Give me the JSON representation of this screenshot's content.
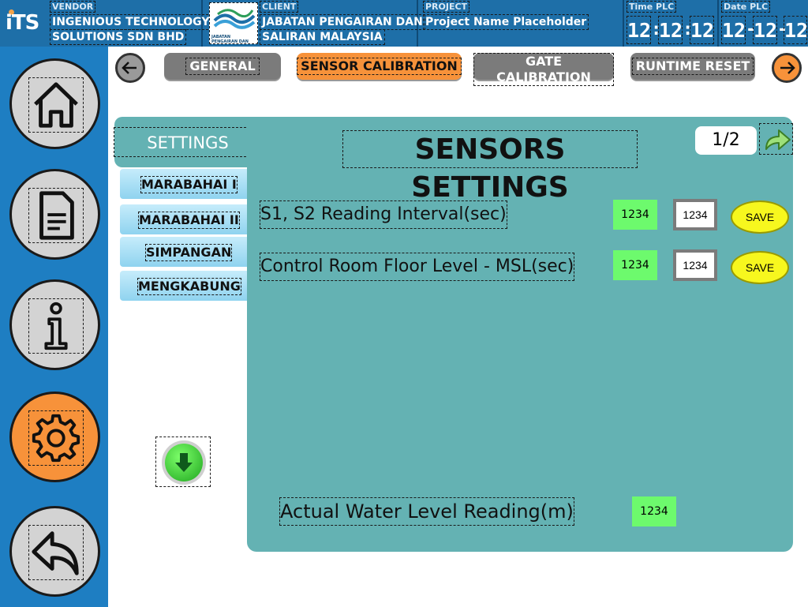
{
  "header": {
    "vendor": {
      "caption": "VENDOR",
      "name_line1": "INGENIOUS TECHNOLOGY",
      "name_line2": "SOLUTIONS SDN BHD",
      "logo_text": "iTS"
    },
    "client": {
      "caption": "CLIENT",
      "name_line1": "JABATAN PENGAIRAN DAN",
      "name_line2": "SALIRAN MALAYSIA",
      "logo_caption": "JABATAN PENGAIRAN DAN SALIRAN MALAYSIA"
    },
    "project": {
      "caption": "PROJECT",
      "name": "Project Name Placeholder"
    },
    "time_plc": {
      "caption": "Time PLC",
      "hh": "12",
      "mm": "12",
      "ss": "12",
      "sep": ":"
    },
    "date_plc": {
      "caption": "Date PLC",
      "dd": "12",
      "mo": "12",
      "yy": "12",
      "sep": "-"
    }
  },
  "sidebar": {
    "items": [
      {
        "icon": "home-icon"
      },
      {
        "icon": "document-icon"
      },
      {
        "icon": "info-icon"
      },
      {
        "icon": "gear-icon",
        "active": true
      },
      {
        "icon": "back-icon"
      }
    ]
  },
  "tabs": {
    "items": [
      {
        "label": "GENERAL",
        "active": false
      },
      {
        "label": "SENSOR CALIBRATION",
        "active": true
      },
      {
        "label": "GATE CALIBRATION",
        "active": false
      },
      {
        "label": "RUNTIME RESET",
        "active": false
      }
    ]
  },
  "settings_label": "SETTINGS",
  "locations": [
    "MARABAHAI I",
    "MARABAHAI II",
    "SIMPANGAN",
    "MENGKABUNG"
  ],
  "panel": {
    "title": "SENSORS SETTINGS",
    "page_indicator": "1/2",
    "rows": [
      {
        "label": "S1, S2 Reading Interval(sec)",
        "value": "1234",
        "input": "1234",
        "save_label": "SAVE"
      },
      {
        "label": "Control Room Floor Level - MSL(sec)",
        "value": "1234",
        "input": "1234",
        "save_label": "SAVE"
      }
    ],
    "water_level": {
      "label": "Actual Water Level Reading(m)",
      "value": "1234"
    }
  },
  "colors": {
    "header_bg": "#1e6fa8",
    "sidebar_bg": "#1e7ec2",
    "panel_bg": "#64b2b3",
    "active_orange": "#f7923a",
    "tab_gray": "#7b7b7b",
    "value_green": "#6dfa6d",
    "save_yellow": "#f7f71e"
  }
}
